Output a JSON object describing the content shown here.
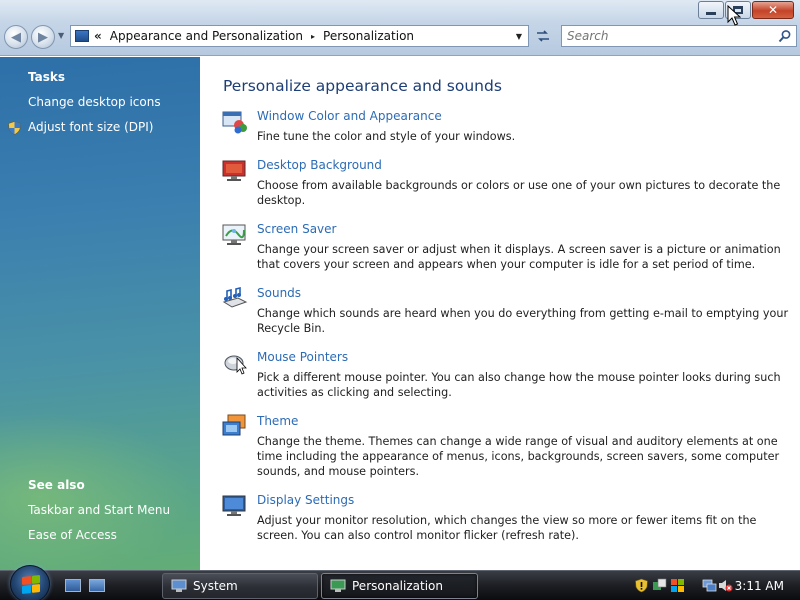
{
  "window": {
    "caption_buttons": [
      "minimize-icon",
      "maximize-icon",
      "close-icon"
    ]
  },
  "address_bar": {
    "chevron": "«",
    "segments": [
      "Appearance and Personalization",
      "Personalization"
    ],
    "separator": "▸"
  },
  "search": {
    "placeholder": "Search"
  },
  "sidebar": {
    "tasks_heading": "Tasks",
    "tasks": [
      {
        "label": "Change desktop icons",
        "icon": null
      },
      {
        "label": "Adjust font size (DPI)",
        "icon": "shield-icon"
      }
    ],
    "see_also_heading": "See also",
    "see_also": [
      {
        "label": "Taskbar and Start Menu"
      },
      {
        "label": "Ease of Access"
      }
    ]
  },
  "main": {
    "title": "Personalize appearance and sounds",
    "items": [
      {
        "title": "Window Color and Appearance",
        "description": "Fine tune the color and style of your windows.",
        "icon": "window-color-icon"
      },
      {
        "title": "Desktop Background",
        "description": "Choose from available backgrounds or colors or use one of your own pictures to decorate the desktop.",
        "icon": "desktop-background-icon"
      },
      {
        "title": "Screen Saver",
        "description": "Change your screen saver or adjust when it displays. A screen saver is a picture or animation that covers your screen and appears when your computer is idle for a set period of time.",
        "icon": "screen-saver-icon"
      },
      {
        "title": "Sounds",
        "description": "Change which sounds are heard when you do everything from getting e-mail to emptying your Recycle Bin.",
        "icon": "sounds-icon"
      },
      {
        "title": "Mouse Pointers",
        "description": "Pick a different mouse pointer. You can also change how the mouse pointer looks during such activities as clicking and selecting.",
        "icon": "mouse-icon"
      },
      {
        "title": "Theme",
        "description": "Change the theme. Themes can change a wide range of visual and auditory elements at one time including the appearance of menus, icons, backgrounds, screen savers, some computer sounds, and mouse pointers.",
        "icon": "theme-icon"
      },
      {
        "title": "Display Settings",
        "description": "Adjust your monitor resolution, which changes the view so more or fewer items fit on the screen. You can also control monitor flicker (refresh rate).",
        "icon": "display-settings-icon"
      }
    ]
  },
  "taskbar": {
    "quick_launch": [
      "show-desktop-icon",
      "switch-windows-icon"
    ],
    "buttons": [
      {
        "label": "System",
        "active": false,
        "icon": "system-icon"
      },
      {
        "label": "Personalization",
        "active": true,
        "icon": "personalization-icon"
      }
    ],
    "tray_icons": [
      "security-alert-icon",
      "network-icon",
      "volume-muted-icon"
    ],
    "clock": "3:11 AM"
  },
  "colors": {
    "link": "#2c6bb5",
    "title": "#1d3e76",
    "sidebar_top": "#2d6fa8",
    "sidebar_bottom": "#63ad77"
  }
}
